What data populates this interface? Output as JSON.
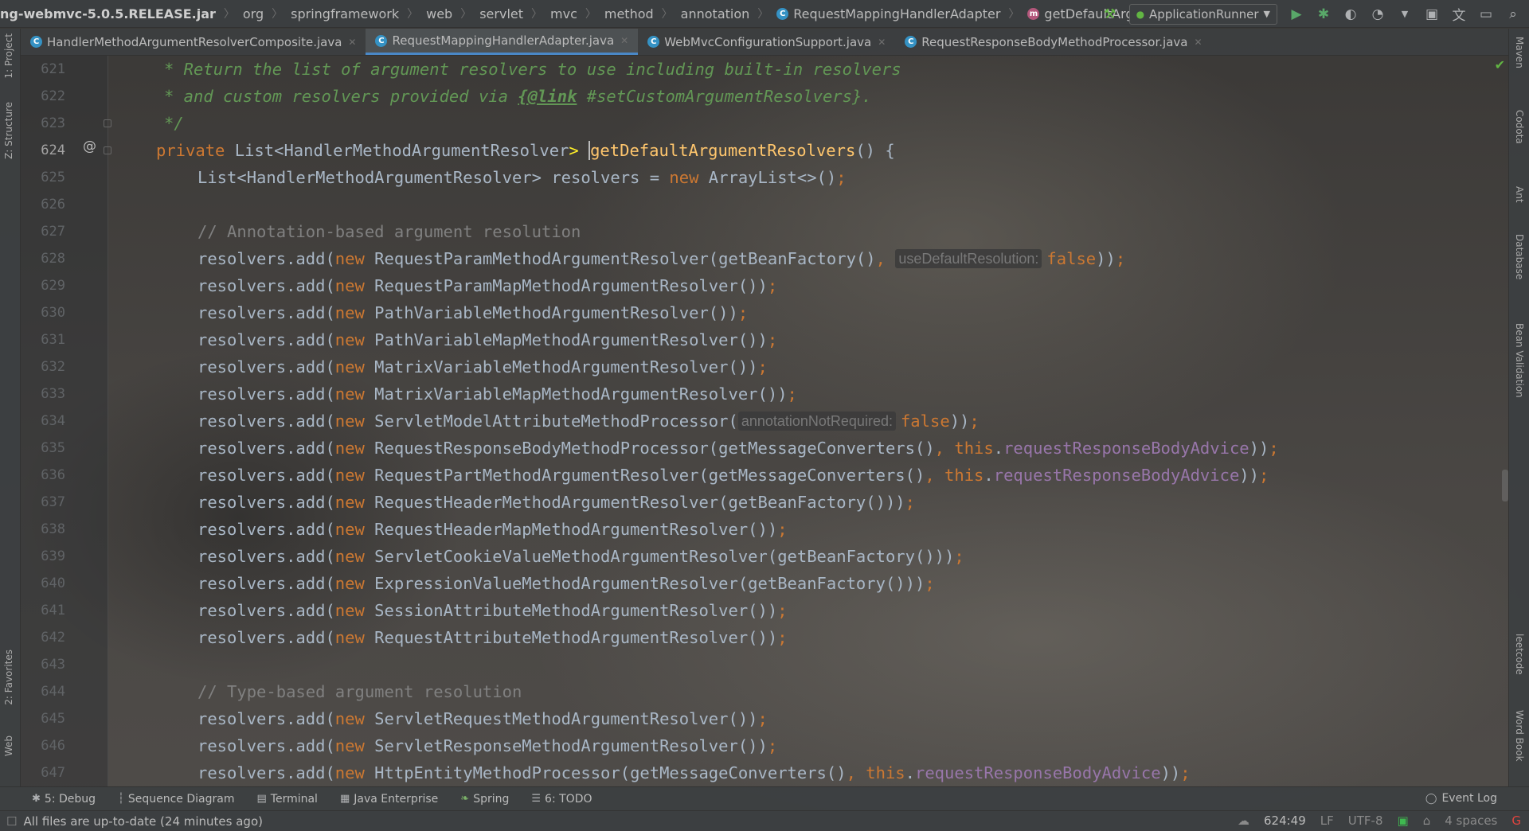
{
  "navbar": {
    "crumbs": [
      "ng-webmvc-5.0.5.RELEASE.jar",
      "org",
      "springframework",
      "web",
      "servlet",
      "mvc",
      "method",
      "annotation",
      "RequestMappingHandlerAdapter",
      "getDefaultArgumentResolvers"
    ],
    "run_config": "ApplicationRunner"
  },
  "tabs": [
    {
      "label": "HandlerMethodArgumentResolverComposite.java"
    },
    {
      "label": "RequestMappingHandlerAdapter.java"
    },
    {
      "label": "WebMvcConfigurationSupport.java"
    },
    {
      "label": "RequestResponseBodyMethodProcessor.java"
    }
  ],
  "left_tools": [
    "1: Project",
    "Z: Structure",
    "2: Favorites",
    "Web"
  ],
  "right_tools": [
    "Maven",
    "Codota",
    "Ant",
    "Database",
    "Bean Validation",
    "leetcode",
    "Word Book"
  ],
  "editor": {
    "line_numbers": [
      "621",
      "622",
      "623",
      "624",
      "625",
      "626",
      "627",
      "628",
      "629",
      "630",
      "631",
      "632",
      "633",
      "634",
      "635",
      "636",
      "637",
      "638",
      "639",
      "640",
      "641",
      "642",
      "643",
      "644",
      "645",
      "646",
      "647"
    ],
    "current_line": "624",
    "lines": {
      "l621": "* Return the list of argument resolvers to use including built-in resolvers",
      "l622a": "* and custom resolvers provided via ",
      "l622tag": "{@link",
      "l622b": " #setCustomArgumentResolvers}.",
      "l623": "*/",
      "l624_kw": "private",
      "l624_type": " List<HandlerMethodArgumentResolver",
      "l624_gt": ">",
      "l624_name": "getDefaultArgumentResolvers",
      "l624_rest": "() {",
      "l625a": "List<HandlerMethodArgumentResolver> resolvers = ",
      "l625kw": "new",
      "l625b": " ArrayList<>()",
      "l625c": ";",
      "l627": "// Annotation-based argument resolution",
      "l644": "// Type-based argument resolution",
      "add_prefix": "resolvers.add(",
      "new_kw": "new",
      "this_kw": "this",
      "field": "requestResponseBodyAdvice",
      "hint_use_default": "useDefaultResolution:",
      "hint_annotation": "annotationNotRequired:",
      "false_kw": "false",
      "r628": " RequestParamMethodArgumentResolver(getBeanFactory()",
      "r629": " RequestParamMapMethodArgumentResolver())",
      "r630": " PathVariableMethodArgumentResolver())",
      "r631": " PathVariableMapMethodArgumentResolver())",
      "r632": " MatrixVariableMethodArgumentResolver())",
      "r633": " MatrixVariableMapMethodArgumentResolver())",
      "r634": " ServletModelAttributeMethodProcessor(",
      "r635": " RequestResponseBodyMethodProcessor(getMessageConverters()",
      "r636": " RequestPartMethodArgumentResolver(getMessageConverters()",
      "r637": " RequestHeaderMethodArgumentResolver(getBeanFactory()))",
      "r638": " RequestHeaderMapMethodArgumentResolver())",
      "r639": " ServletCookieValueMethodArgumentResolver(getBeanFactory()))",
      "r640": " ExpressionValueMethodArgumentResolver(getBeanFactory()))",
      "r641": " SessionAttributeMethodArgumentResolver())",
      "r642": " RequestAttributeMethodArgumentResolver())",
      "r645": " ServletRequestMethodArgumentResolver())",
      "r646": " ServletResponseMethodArgumentResolver())",
      "r647": " HttpEntityMethodProcessor(getMessageConverters()"
    }
  },
  "bottom_tools": [
    "5: Debug",
    "Sequence Diagram",
    "Terminal",
    "Java Enterprise",
    "Spring",
    "6: TODO"
  ],
  "event_log": "Event Log",
  "status": {
    "message": "All files are up-to-date (24 minutes ago)",
    "position": "624:49",
    "line_sep": "LF",
    "encoding": "UTF-8",
    "indent": "4 spaces"
  },
  "colors": {
    "keyword": "#cc7832",
    "doc_comment": "#629755",
    "comment": "#808080",
    "field": "#9876aa",
    "method_decl": "#ffc66d",
    "accent": "#4a88c7"
  }
}
